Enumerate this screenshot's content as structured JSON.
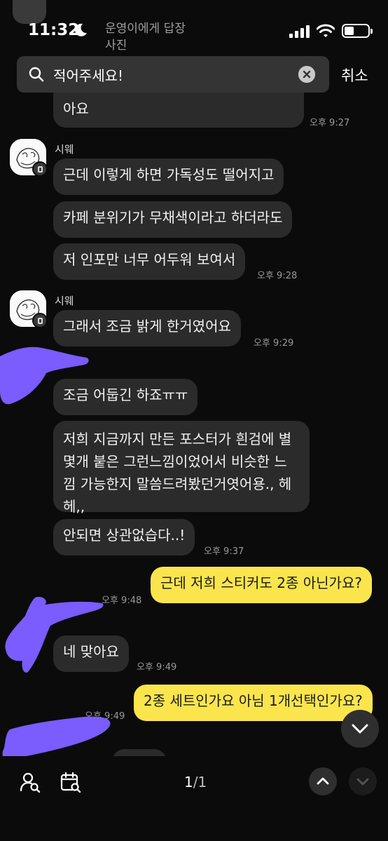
{
  "status_bar": {
    "time": "11:32"
  },
  "reply_preview": {
    "line1": "운영이에게 답장",
    "line2": "사진"
  },
  "search": {
    "query": "적어주세요!",
    "cancel_label": "취소"
  },
  "messages": {
    "m0": {
      "text": "지는 원석 보다는 회색이 더 예쁜 것 같아요",
      "line2": "아요",
      "time": "오후 9:27"
    },
    "sender1": "시웨",
    "m1": {
      "text": "근데 이렇게 하면 가독성도 떨어지고"
    },
    "m2": {
      "text": "카페 분위기가 무채색이라고 하더라도"
    },
    "m3": {
      "text": "저 인포만 너무 어두워 보여서",
      "time": "오후 9:28"
    },
    "sender2": "시웨",
    "m4": {
      "text": "그래서 조금 밝게 한거였어요",
      "time": "오후 9:29"
    },
    "m5": {
      "text": "조금 어둡긴 하죠ㅠㅠ"
    },
    "m6": {
      "text": "저희 지금까지 만든 포스터가 흰검에 별 몇개 붙은 그런느낌이었어서 비슷한 느낌 가능한지 말씀드려봤던거엿어용., 헤헤,,"
    },
    "m7": {
      "text": "안되면 상관없습다..!",
      "time": "오후 9:37"
    },
    "m8": {
      "text": "근데 저희 스티커도 2종 아닌가요?",
      "time": "오후 9:48"
    },
    "m9": {
      "text": "네 맞아요",
      "time": "오후 9:49"
    },
    "m10": {
      "text": "2종 세트인가요 아님 1개선택인가요?",
      "time": "오후 9:49"
    }
  },
  "bottom_bar": {
    "current": "1",
    "total": "/1"
  },
  "colors": {
    "my_bubble": "#fbe54d",
    "other_bubble": "#2b2b2b",
    "redaction": "#7a5cff",
    "background": "#0b0b0b"
  }
}
